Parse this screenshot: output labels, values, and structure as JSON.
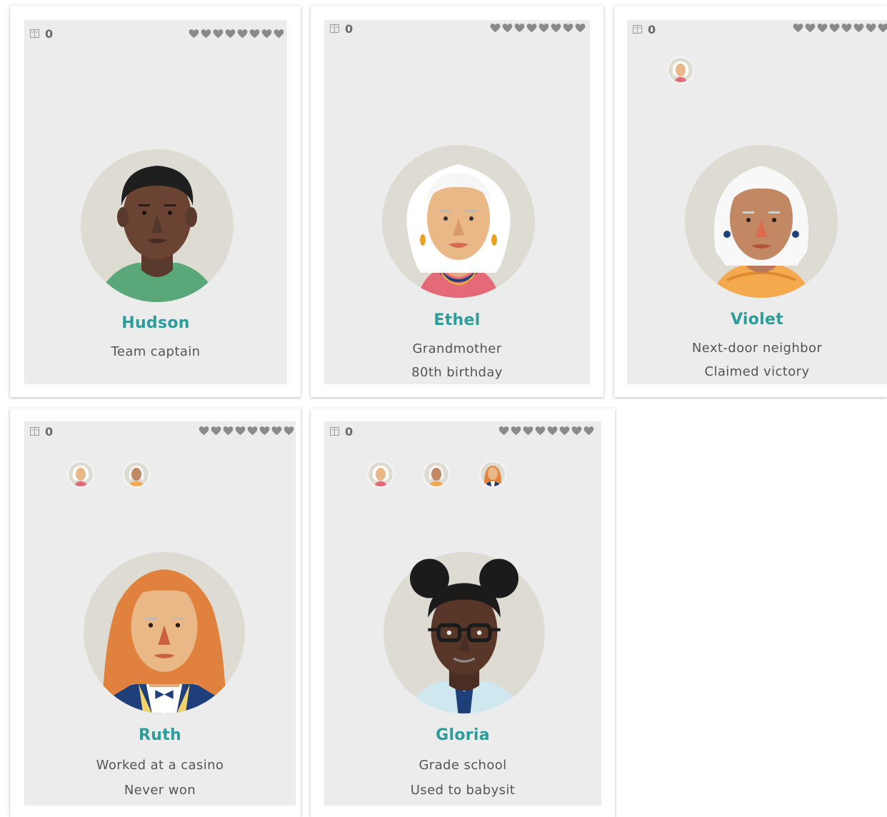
{
  "characters": [
    {
      "name": "Hudson",
      "lines": [
        "Team captain"
      ],
      "score": "0",
      "hearts": 8
    },
    {
      "name": "Ethel",
      "lines": [
        "Grandmother",
        "80th birthday"
      ],
      "score": "0",
      "hearts": 8
    },
    {
      "name": "Violet",
      "lines": [
        "Next-door neighbor",
        "Claimed victory"
      ],
      "score": "0",
      "hearts": 8
    },
    {
      "name": "Ruth",
      "lines": [
        "Worked at a casino",
        "Never won"
      ],
      "score": "0",
      "hearts": 8
    },
    {
      "name": "Gloria",
      "lines": [
        "Grade school",
        "Used to babysit"
      ],
      "score": "0",
      "hearts": 8
    }
  ],
  "colors": {
    "accent": "#2d9d99",
    "panel": "#ececec",
    "portrait_bg": "#dedbd2",
    "heart": "#8a8a8a"
  },
  "icons": {
    "score": "book-icon",
    "life": "heart-icon"
  }
}
